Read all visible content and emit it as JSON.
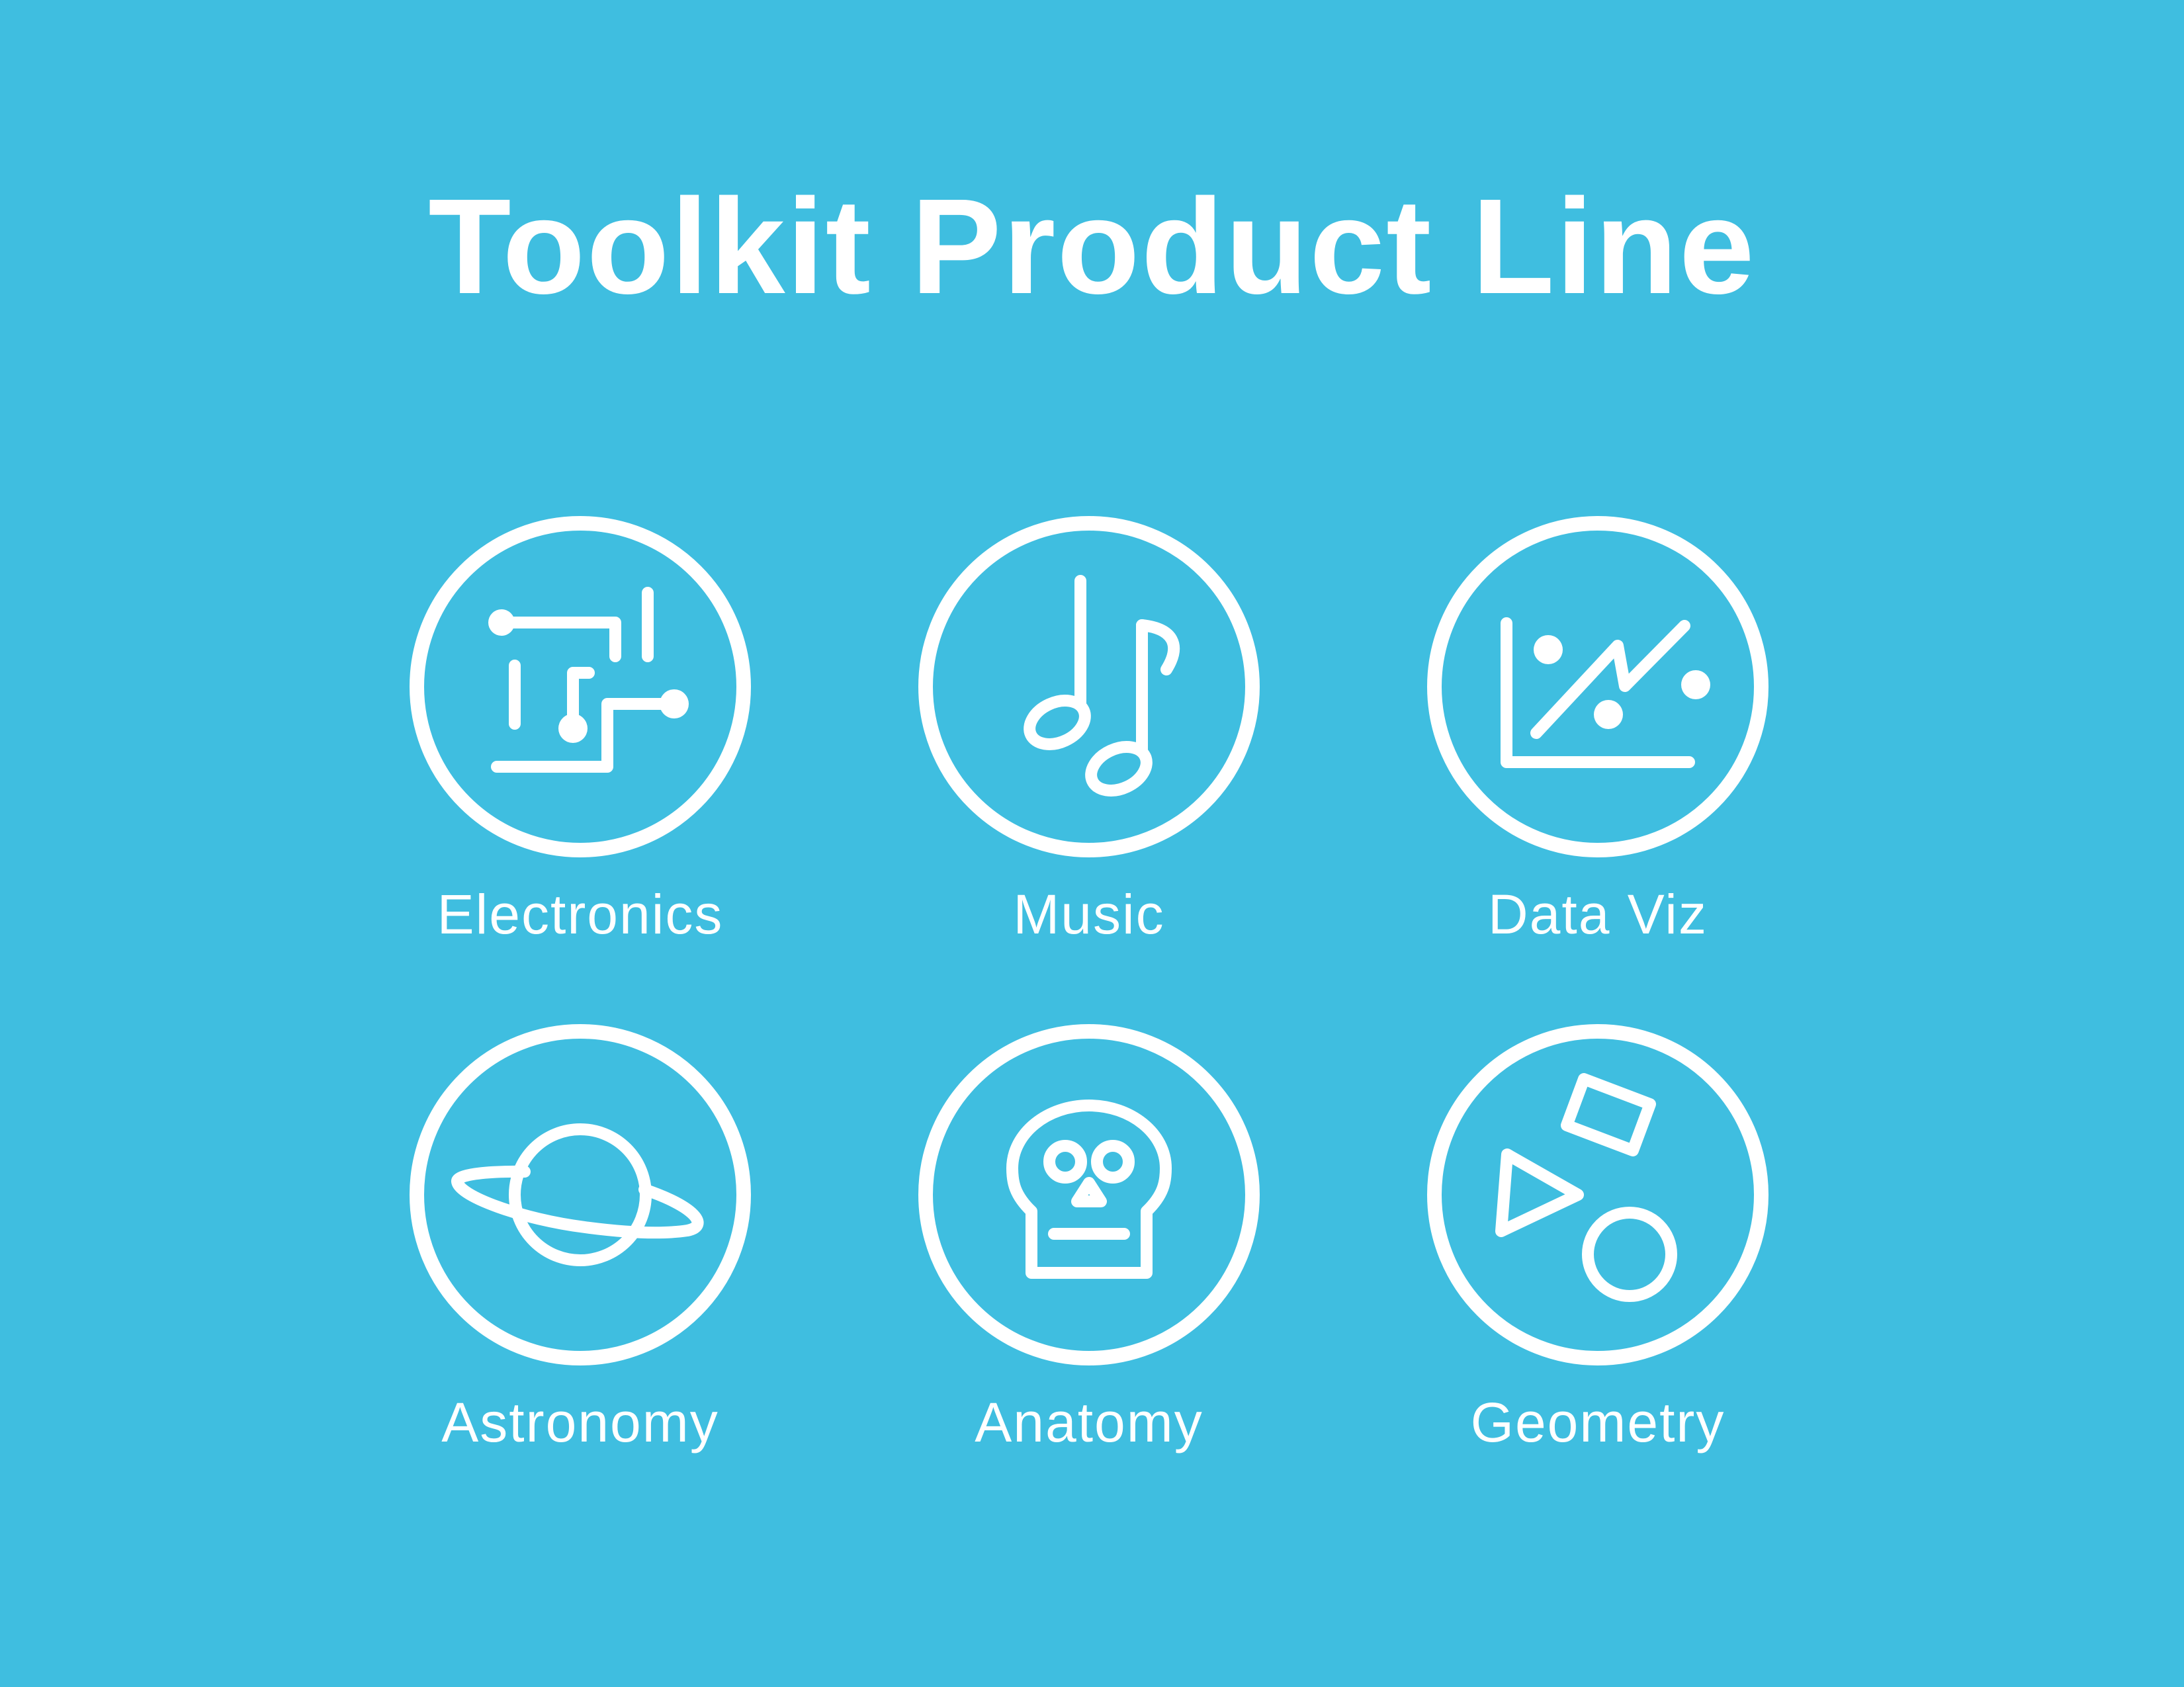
{
  "title": "Toolkit Product Line",
  "colors": {
    "background": "#3fbee0",
    "foreground": "#ffffff"
  },
  "products": [
    {
      "label": "Electronics",
      "icon": "circuit-icon"
    },
    {
      "label": "Music",
      "icon": "music-note-icon"
    },
    {
      "label": "Data Viz",
      "icon": "chart-icon"
    },
    {
      "label": "Astronomy",
      "icon": "planet-icon"
    },
    {
      "label": "Anatomy",
      "icon": "skull-icon"
    },
    {
      "label": "Geometry",
      "icon": "shapes-icon"
    }
  ]
}
